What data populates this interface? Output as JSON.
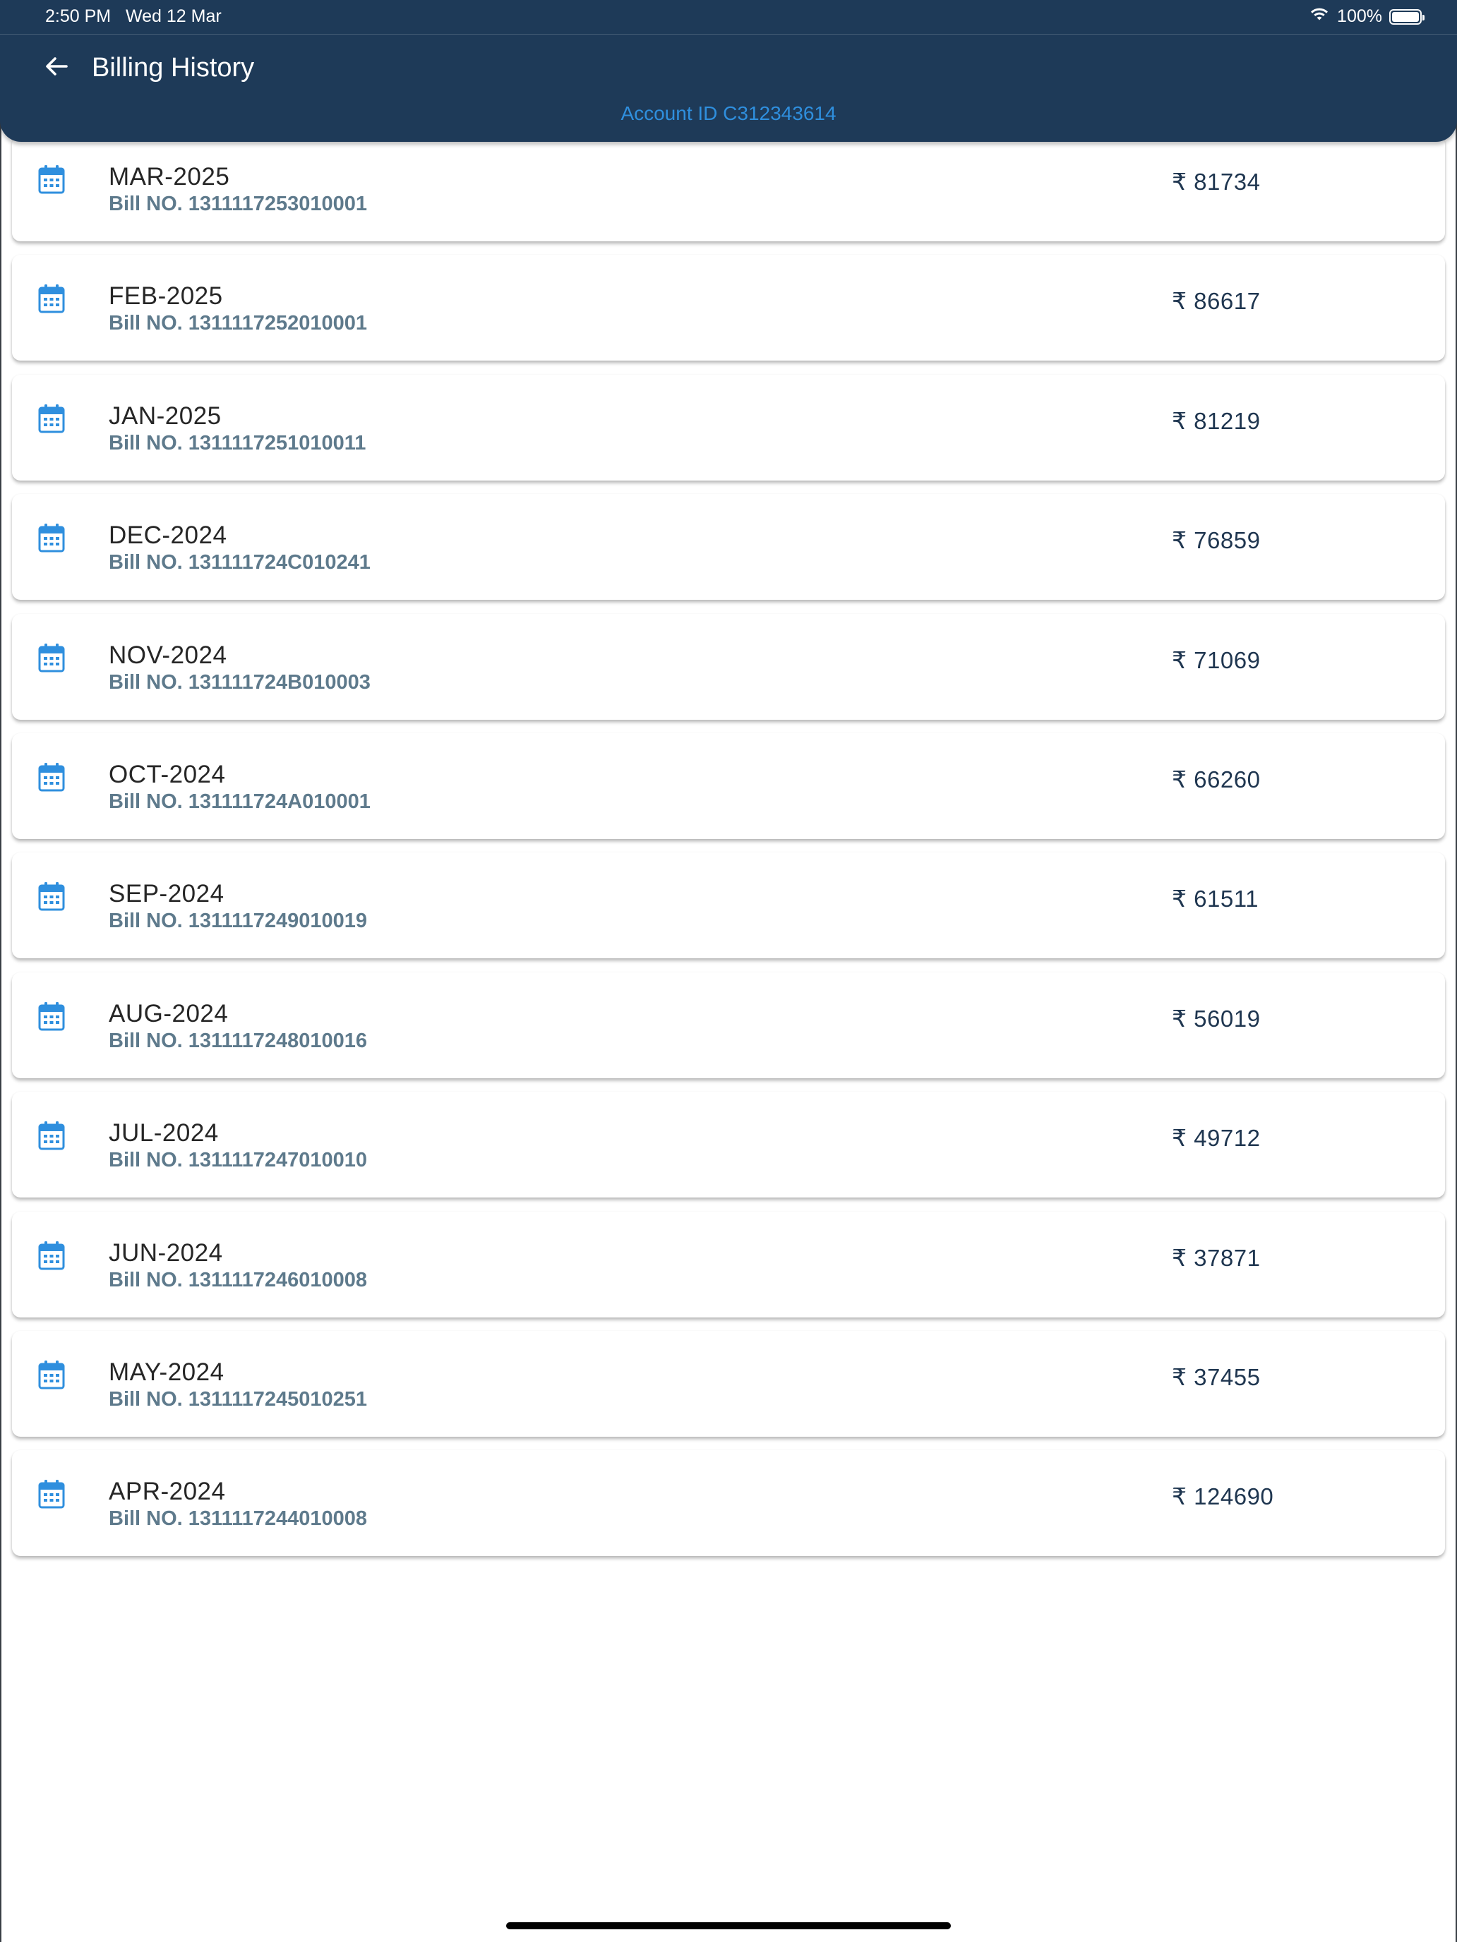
{
  "status_bar": {
    "time": "2:50 PM",
    "date": "Wed 12 Mar",
    "battery": "100%",
    "battery_level": 1.0,
    "wifi_icon": "wifi-icon",
    "battery_icon": "battery-icon"
  },
  "header": {
    "title": "Billing History",
    "account_line": "Account ID C312343614",
    "back_icon": "arrow-left-icon"
  },
  "colors": {
    "header_bg": "#1e3a58",
    "accent_blue": "#2f8fde",
    "month_text": "#262626",
    "bill_text": "#5e7a8c",
    "amount_text": "#1f3650"
  },
  "bills": [
    {
      "month": "MAR-2025",
      "bill_no": "Bill NO. 1311117253010001",
      "amount": "₹ 81734"
    },
    {
      "month": "FEB-2025",
      "bill_no": "Bill NO. 1311117252010001",
      "amount": "₹ 86617"
    },
    {
      "month": "JAN-2025",
      "bill_no": "Bill NO. 1311117251010011",
      "amount": "₹ 81219"
    },
    {
      "month": "DEC-2024",
      "bill_no": "Bill NO. 131111724C010241",
      "amount": "₹ 76859"
    },
    {
      "month": "NOV-2024",
      "bill_no": "Bill NO. 131111724B010003",
      "amount": "₹ 71069"
    },
    {
      "month": "OCT-2024",
      "bill_no": "Bill NO. 131111724A010001",
      "amount": "₹ 66260"
    },
    {
      "month": "SEP-2024",
      "bill_no": "Bill NO. 1311117249010019",
      "amount": "₹ 61511"
    },
    {
      "month": "AUG-2024",
      "bill_no": "Bill NO. 1311117248010016",
      "amount": "₹ 56019"
    },
    {
      "month": "JUL-2024",
      "bill_no": "Bill NO. 1311117247010010",
      "amount": "₹ 49712"
    },
    {
      "month": "JUN-2024",
      "bill_no": "Bill NO. 1311117246010008",
      "amount": "₹ 37871"
    },
    {
      "month": "MAY-2024",
      "bill_no": "Bill NO. 1311117245010251",
      "amount": "₹ 37455"
    },
    {
      "month": "APR-2024",
      "bill_no": "Bill NO. 1311117244010008",
      "amount": "₹ 124690"
    }
  ],
  "bill_icon": "calendar-icon"
}
